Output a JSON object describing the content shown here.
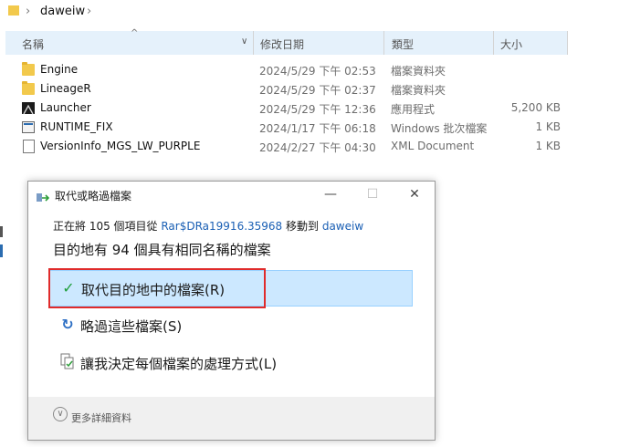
{
  "breadcrumb": {
    "folder": "daweiw"
  },
  "columns": {
    "name": "名稱",
    "date": "修改日期",
    "type": "類型",
    "size": "大小"
  },
  "files": [
    {
      "name": "Engine",
      "date": "2024/5/29 下午 02:53",
      "type": "檔案資料夾",
      "size": "",
      "icon": "folder-icon"
    },
    {
      "name": "LineageR",
      "date": "2024/5/29 下午 02:37",
      "type": "檔案資料夾",
      "size": "",
      "icon": "folder-icon"
    },
    {
      "name": "Launcher",
      "date": "2024/5/29 下午 12:36",
      "type": "應用程式",
      "size": "5,200 KB",
      "icon": "app-icon"
    },
    {
      "name": "RUNTIME_FIX",
      "date": "2024/1/17 下午 06:18",
      "type": "Windows 批次檔案",
      "size": "1 KB",
      "icon": "batch-file-icon"
    },
    {
      "name": "VersionInfo_MGS_LW_PURPLE",
      "date": "2024/2/27 下午 04:30",
      "type": "XML Document",
      "size": "1 KB",
      "icon": "xml-file-icon"
    }
  ],
  "dialog": {
    "title": "取代或略過檔案",
    "progress_prefix": "正在將 105 個項目從 ",
    "source": "Rar$DRa19916.35968",
    "progress_middle": " 移動到 ",
    "destination": "daweiw",
    "headline": "目的地有 94 個具有相同名稱的檔案",
    "options": {
      "replace": "取代目的地中的檔案(R)",
      "skip": "略過這些檔案(S)",
      "decide": "讓我決定每個檔案的處理方式(L)"
    },
    "more_details": "更多詳細資料"
  },
  "colors": {
    "accent": "#1a5fb4",
    "highlight": "#cce8ff",
    "annotation": "#e02b2b",
    "check": "#1e9e3a"
  }
}
